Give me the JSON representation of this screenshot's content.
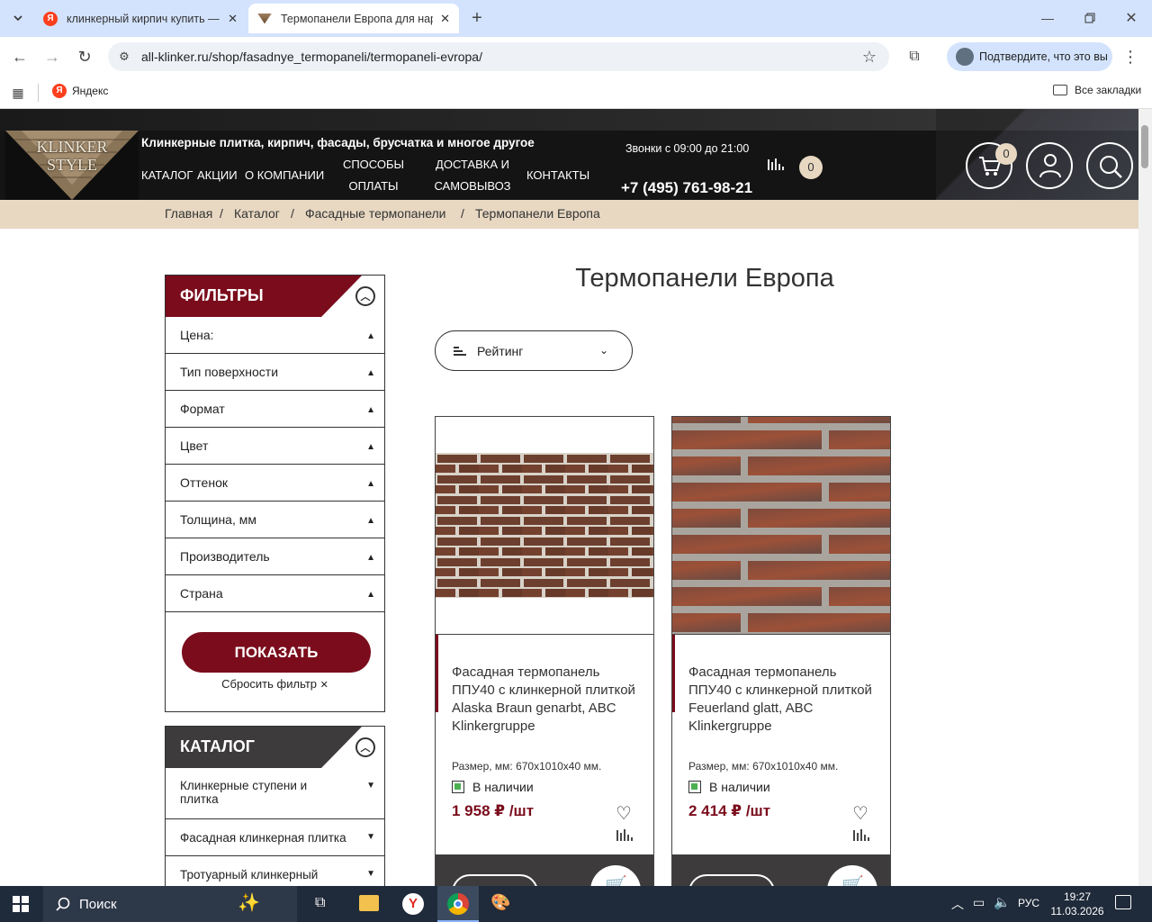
{
  "browser": {
    "tabs": [
      {
        "title": "клинкерный кирпич купить —",
        "active": false
      },
      {
        "title": "Термопанели Европа для нар",
        "active": true
      }
    ],
    "url": "all-klinker.ru/shop/fasadnye_termopaneli/termopaneli-evropa/",
    "profile_prompt": "Подтвердите, что это вы",
    "bookmarks": [
      {
        "label": "Яндекс"
      }
    ],
    "all_bookmarks": "Все закладки"
  },
  "site": {
    "logo": {
      "line1": "KLINKER",
      "line2": "STYLE"
    },
    "tagline": "Клинкерные плитка, кирпич, фасады, брусчатка и многое другое",
    "nav": [
      {
        "label": "КАТАЛОГ"
      },
      {
        "label": "АКЦИИ"
      },
      {
        "label": "О КОМПАНИИ"
      },
      {
        "label": "СПОСОБЫ ОПЛАТЫ"
      },
      {
        "label": "ДОСТАВКА И САМОВЫВОЗ"
      },
      {
        "label": "КОНТАКТЫ"
      }
    ],
    "hours": "Звонки с 09:00 до 21:00",
    "phone": "+7 (495) 761-98-21",
    "compare_count": "0",
    "cart_count": "0"
  },
  "breadcrumbs": [
    "Главная",
    "Каталог",
    "Фасадные термопанели",
    "Термопанели Европа"
  ],
  "page_title": "Термопанели Европа",
  "sort": {
    "label": "Рейтинг"
  },
  "filters": {
    "title": "ФИЛЬТРЫ",
    "items": [
      "Цена:",
      "Тип поверхности",
      "Формат",
      "Цвет",
      "Оттенок",
      "Толщина, мм",
      "Производитель",
      "Страна"
    ],
    "show_button": "ПОКАЗАТЬ",
    "reset": "Сбросить фильтр"
  },
  "catalog": {
    "title": "КАТАЛОГ",
    "items": [
      "Клинкерные ступени и плитка",
      "Фасадная клинкерная плитка",
      "Тротуарный клинкерный"
    ]
  },
  "products": [
    {
      "title": "Фасадная термопанель ППУ40 с клинкерной плиткой Alaska Braun genarbt, ABC Klinkergruppe",
      "size": "Размер, мм: 670х1010х40 мм.",
      "stock": "В наличии",
      "price": "1 958 ₽ /шт"
    },
    {
      "title": "Фасадная термопанель ППУ40 с клинкерной плиткой Feuerland glatt, ABC Klinkergruppe",
      "size": "Размер, мм: 670х1010х40 мм.",
      "stock": "В наличии",
      "price": "2 414 ₽ /шт"
    }
  ],
  "taskbar": {
    "search": "Поиск",
    "lang": "РУС",
    "time": "19:27",
    "date": "11.03.2026"
  }
}
